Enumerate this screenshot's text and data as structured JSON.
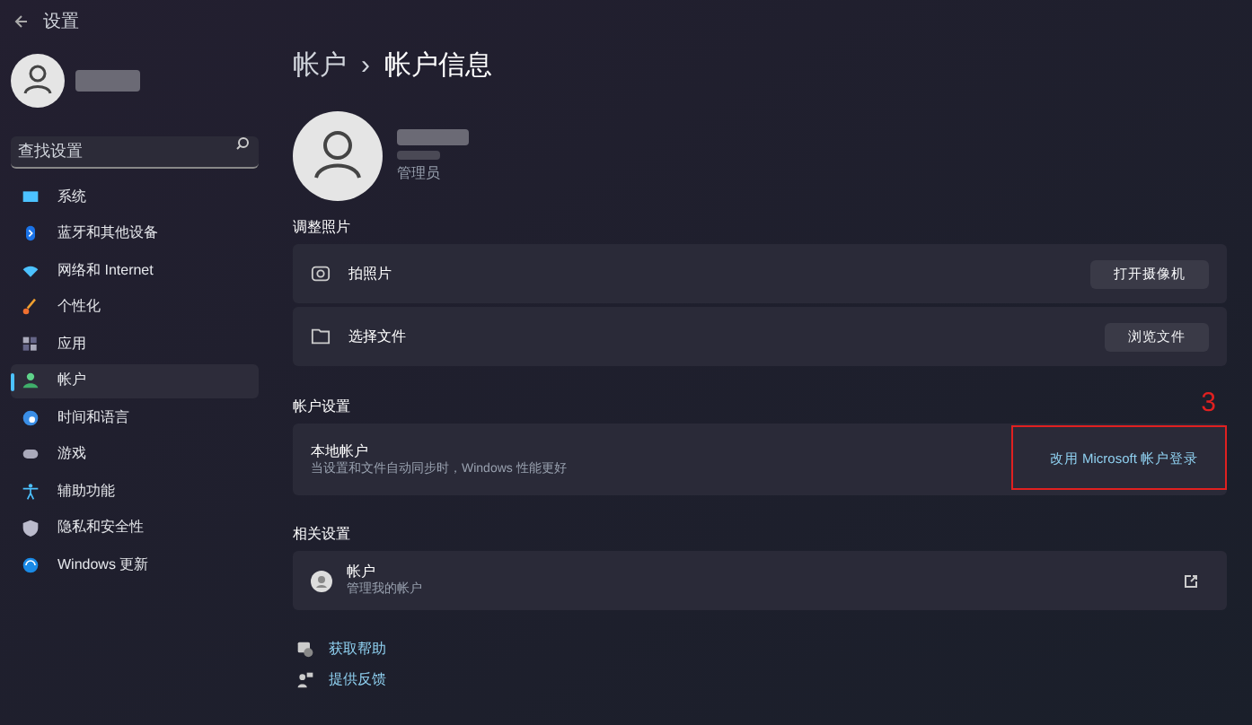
{
  "window": {
    "title": "设置"
  },
  "search": {
    "placeholder": "查找设置"
  },
  "sidebar": {
    "items": [
      {
        "label": "系统",
        "selected": false
      },
      {
        "label": "蓝牙和其他设备",
        "selected": false
      },
      {
        "label": "网络和 Internet",
        "selected": false
      },
      {
        "label": "个性化",
        "selected": false
      },
      {
        "label": "应用",
        "selected": false
      },
      {
        "label": "帐户",
        "selected": true
      },
      {
        "label": "时间和语言",
        "selected": false
      },
      {
        "label": "游戏",
        "selected": false
      },
      {
        "label": "辅助功能",
        "selected": false
      },
      {
        "label": "隐私和安全性",
        "selected": false
      },
      {
        "label": "Windows 更新",
        "selected": false
      }
    ]
  },
  "breadcrumb": {
    "parent": "帐户",
    "separator": "›",
    "current": "帐户信息"
  },
  "profile": {
    "role": "管理员"
  },
  "photo_section": {
    "title": "调整照片",
    "rows": [
      {
        "label": "拍照片",
        "button": "打开摄像机"
      },
      {
        "label": "选择文件",
        "button": "浏览文件"
      }
    ]
  },
  "account_settings": {
    "title": "帐户设置",
    "label": "本地帐户",
    "description": "当设置和文件自动同步时，Windows 性能更好",
    "link": "改用 Microsoft 帐户登录",
    "annotation": "3"
  },
  "related": {
    "title": "相关设置",
    "label": "帐户",
    "description": "管理我的帐户"
  },
  "footer_links": [
    {
      "label": "获取帮助"
    },
    {
      "label": "提供反馈"
    }
  ]
}
